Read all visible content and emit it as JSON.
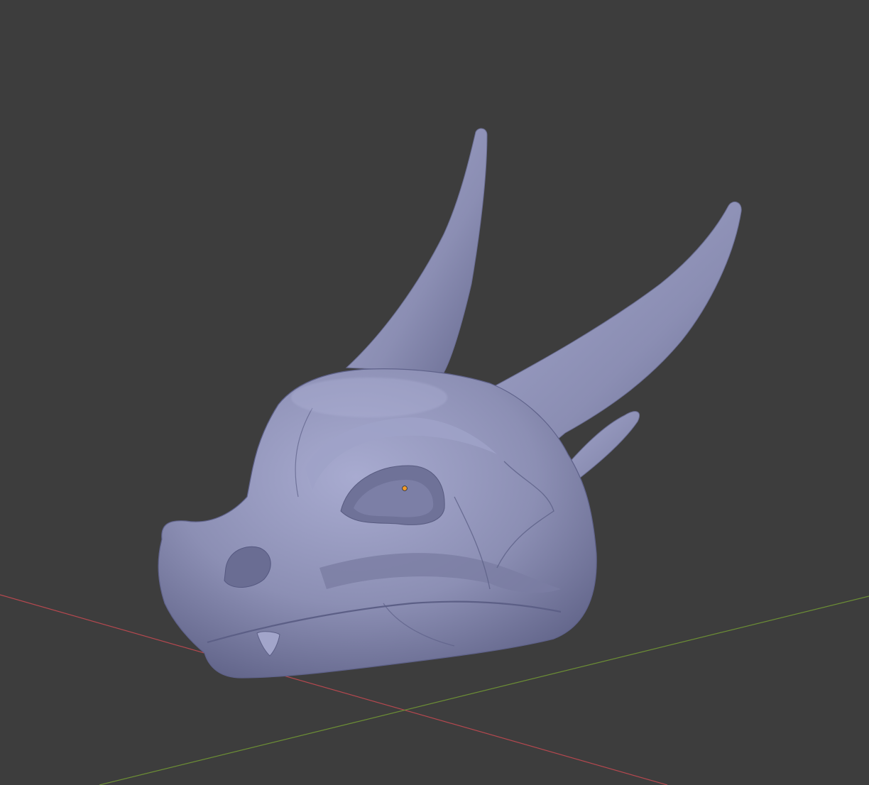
{
  "viewport": {
    "background_color": "#3d3d3d",
    "x_axis_color": "#b5484f",
    "y_axis_color": "#6c8e35",
    "mesh_color": "#8c8fb4",
    "origin_color": "#f29b2a",
    "object": "sculpted-dragon-head-mesh"
  }
}
